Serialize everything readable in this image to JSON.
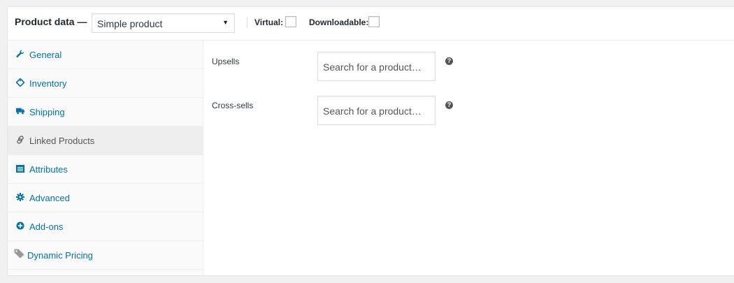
{
  "header": {
    "title": "Product data —",
    "product_type": "Simple product",
    "virtual_label": "Virtual:",
    "downloadable_label": "Downloadable:"
  },
  "tabs": [
    {
      "label": "General",
      "icon": "wrench-icon"
    },
    {
      "label": "Inventory",
      "icon": "tag-icon"
    },
    {
      "label": "Shipping",
      "icon": "truck-icon"
    },
    {
      "label": "Linked Products",
      "icon": "link-icon",
      "active": true
    },
    {
      "label": "Attributes",
      "icon": "list-icon"
    },
    {
      "label": "Advanced",
      "icon": "gear-icon"
    },
    {
      "label": "Add-ons",
      "icon": "plus-circle-icon"
    },
    {
      "label": "Dynamic Pricing",
      "icon": "price-tag-icon"
    }
  ],
  "fields": {
    "upsells": {
      "label": "Upsells",
      "placeholder": "Search for a product…"
    },
    "crosssells": {
      "label": "Cross-sells",
      "placeholder": "Search for a product…"
    }
  },
  "colors": {
    "accent": "#0073aa",
    "active_tab_bg": "#eeeeee"
  }
}
